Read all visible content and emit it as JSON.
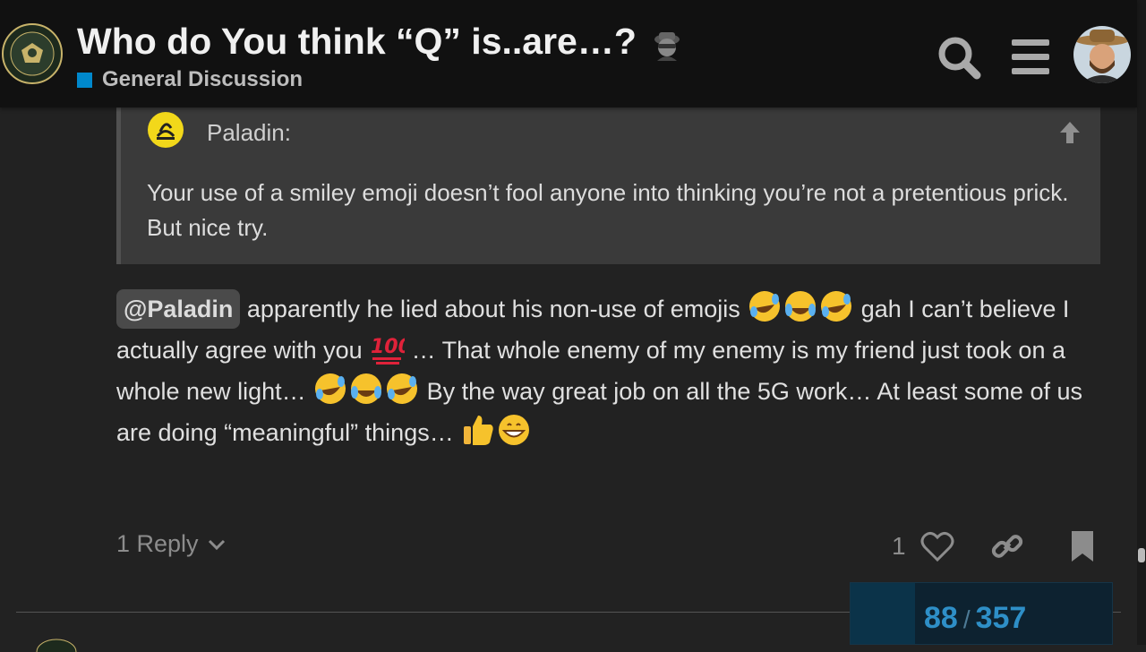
{
  "header": {
    "title": "Who do You think “Q” is..are…?",
    "title_emoji": "detective-icon",
    "category": "General Discussion",
    "category_color": "#0088cc",
    "icons": [
      "search-icon",
      "hamburger-menu-icon",
      "user-avatar"
    ]
  },
  "quote": {
    "username": "Paladin:",
    "text": "Your use of a smiley emoji doesn’t fool anyone into thinking you’re not a pretentious prick. But nice try."
  },
  "post": {
    "mention": "@Paladin",
    "seg1": " apparently he lied about his non-use of emojis ",
    "seg2": " gah I can’t believe I actually agree with you ",
    "seg3": " … That whole enemy of my enemy is my friend just took on a whole new light… ",
    "seg4": " By the way great job on all the 5G work… At least some of us are doing “meaningful” things… "
  },
  "actions": {
    "reply_label": "1 Reply",
    "like_count": "1"
  },
  "progress": {
    "current": "88",
    "total": "357",
    "fraction": 0.246
  }
}
